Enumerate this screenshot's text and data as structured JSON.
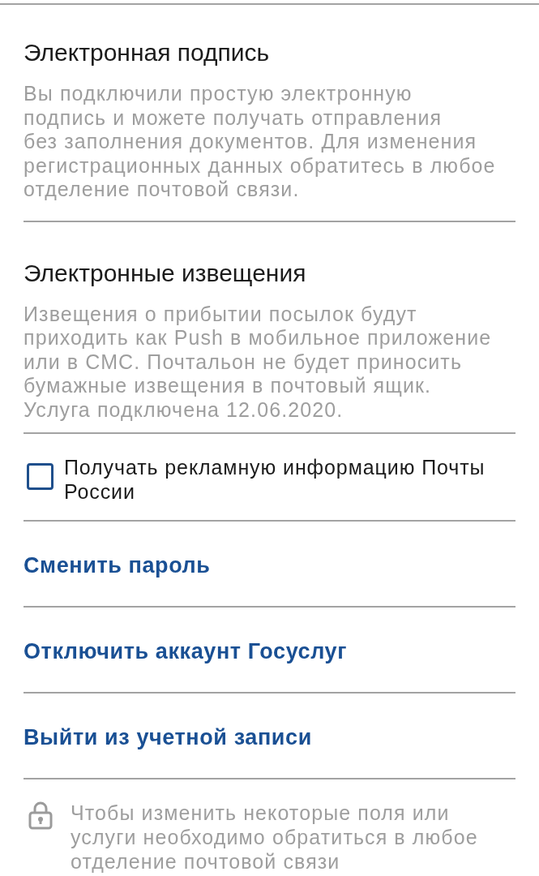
{
  "sections": [
    {
      "title": "Электронная подпись",
      "text": "Вы подключили простую электронную\nподпись и можете получать отправления\nбез заполнения документов. Для изменения\nрегистрационных данных обратитесь в любое\nотделение почтовой связи."
    },
    {
      "title": "Электронные извещения",
      "text": "Извещения о прибытии посылок будут\nприходить как Push в мобильное приложение\nили в СМС. Почтальон не будет приносить\nбумажные извещения в почтовый ящик.\nУслуга подключена 12.06.2020."
    }
  ],
  "checkbox": {
    "label": "Получать рекламную информацию Почты России",
    "checked": false
  },
  "links": [
    "Сменить пароль",
    "Отключить аккаунт Госуслуг",
    "Выйти из учетной записи"
  ],
  "note": {
    "text": "Чтобы изменить некоторые поля или\nуслуги необходимо обратиться в любое\nотделение почтовой связи"
  }
}
